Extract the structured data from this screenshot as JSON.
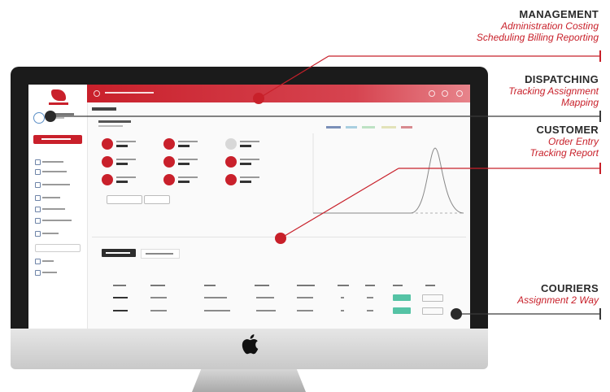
{
  "callouts": {
    "management": {
      "title": "MANAGEMENT",
      "lines": [
        "Administration Costing",
        "Scheduling Billing Reporting"
      ]
    },
    "dispatching": {
      "title": "DISPATCHING",
      "lines": [
        "Tracking Assignment",
        "Mapping"
      ]
    },
    "customer": {
      "title": "CUSTOMER",
      "lines": [
        "Order Entry",
        "Tracking Report"
      ]
    },
    "couriers": {
      "title": "COURIERS",
      "lines": [
        "Assignment 2 Way"
      ]
    }
  },
  "colors": {
    "accent": "#c8202a",
    "title_text": "#2a2a2a",
    "badge_green": "#55c3a5",
    "sidebar_icon": "#6e84a8"
  },
  "icons": {
    "device": "imac-icon",
    "brand": "apple-logo-icon"
  }
}
